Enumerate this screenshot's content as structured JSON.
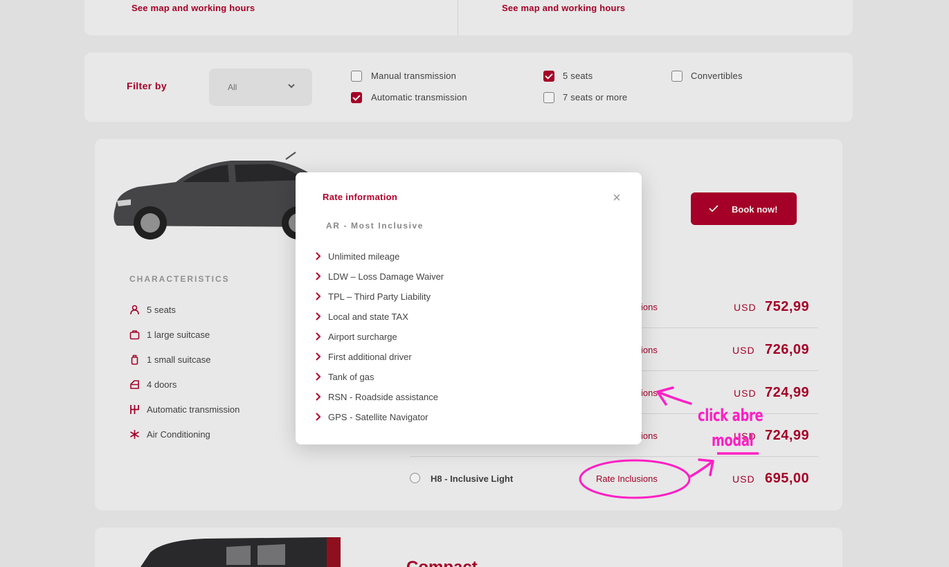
{
  "locations": {
    "left_link": "See map and working hours",
    "right_link": "See map and working hours"
  },
  "filter": {
    "title": "Filter by",
    "select_value": "All",
    "options": [
      {
        "label": "Manual transmission",
        "checked": false
      },
      {
        "label": "Automatic transmission",
        "checked": true
      },
      {
        "label": "5 seats",
        "checked": true
      },
      {
        "label": "7 seats or more",
        "checked": false
      },
      {
        "label": "Convertibles",
        "checked": false
      }
    ]
  },
  "car": {
    "book_label": "Book now!",
    "characteristics_title": "CHARACTERISTICS",
    "characteristics": [
      {
        "icon": "person-icon",
        "label": "5 seats"
      },
      {
        "icon": "suitcase-icon",
        "label": "1 large suitcase"
      },
      {
        "icon": "small-suitcase-icon",
        "label": "1 small suitcase"
      },
      {
        "icon": "door-icon",
        "label": "4 doors"
      },
      {
        "icon": "gearbox-icon",
        "label": "Automatic transmission"
      },
      {
        "icon": "snowflake-icon",
        "label": "Air Conditioning"
      }
    ],
    "rates": [
      {
        "name": "",
        "inclusions": "Rate Inclusions",
        "currency": "USD",
        "price": "752,99"
      },
      {
        "name": "",
        "inclusions": "Rate Inclusions",
        "currency": "USD",
        "price": "726,09"
      },
      {
        "name": "",
        "inclusions": "Rate Inclusions",
        "currency": "USD",
        "price": "724,99"
      },
      {
        "name": "",
        "inclusions": "Rate Inclusions",
        "currency": "USD",
        "price": "724,99"
      },
      {
        "name": "H8 - Inclusive Light",
        "inclusions": "Rate Inclusions",
        "currency": "USD",
        "price": "695,00"
      }
    ]
  },
  "next_card": {
    "title": "Compact"
  },
  "modal": {
    "title": "Rate information",
    "close_symbol": "×",
    "subtitle": "AR - Most Inclusive",
    "items": [
      "Unlimited mileage",
      "LDW – Loss Damage Waiver",
      "TPL – Third Party Liability",
      "Local and state TAX",
      "Airport surcharge",
      "First additional driver",
      "Tank of gas",
      "RSN - Roadside assistance",
      "GPS - Satellite Navigator"
    ]
  },
  "annotation": {
    "line1": "click abre",
    "line2": "modal",
    "color": "#ff1fc4"
  },
  "colors": {
    "brand": "#b0002a",
    "background": "#ededed",
    "card": "#f7f7f7"
  }
}
